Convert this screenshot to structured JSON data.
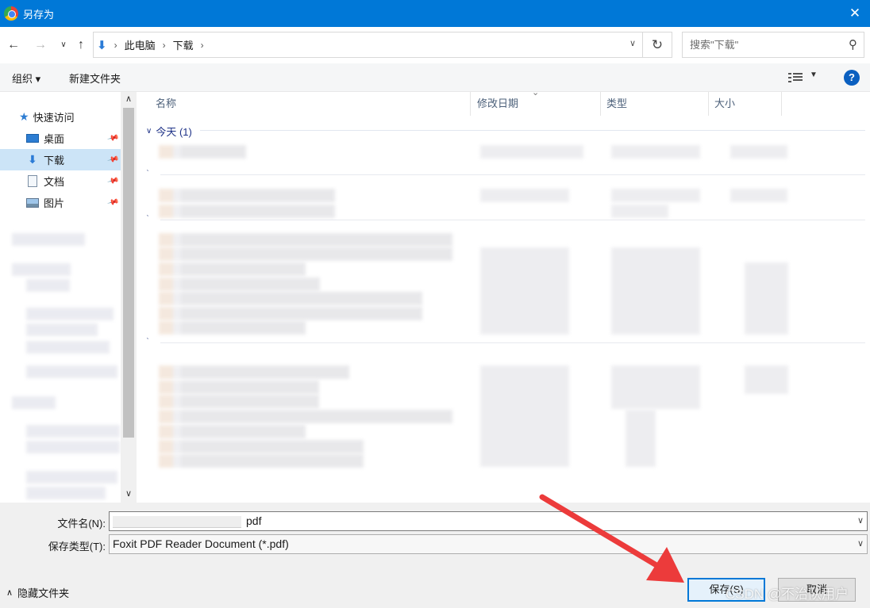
{
  "window": {
    "title": "另存为"
  },
  "address": {
    "crumbs": [
      "此电脑",
      "下载"
    ],
    "search_placeholder": "搜索\"下载\""
  },
  "toolbar": {
    "organize": "组织 ▾",
    "new_folder": "新建文件夹"
  },
  "nav": {
    "quick_access": "快速访问",
    "items": [
      {
        "label": "桌面",
        "icon": "desktop-icon"
      },
      {
        "label": "下载",
        "icon": "download-icon",
        "selected": true
      },
      {
        "label": "文档",
        "icon": "document-icon"
      },
      {
        "label": "图片",
        "icon": "pictures-icon"
      }
    ]
  },
  "columns": [
    "名称",
    "修改日期",
    "类型",
    "大小"
  ],
  "groups": {
    "today": "今天 (1)"
  },
  "form": {
    "filename_label": "文件名(N):",
    "filename_value": "pdf",
    "filetype_label": "保存类型(T):",
    "filetype_value": "Foxit PDF Reader Document (*.pdf)"
  },
  "footer": {
    "hide_folders": "隐藏文件夹",
    "save": "保存(S)",
    "cancel": "取消"
  },
  "watermark": "CSDN @不治队用户",
  "colors": {
    "titlebar": "#0078d7",
    "selected": "#cce4f7",
    "annotation_arrow": "#ec3b3b"
  }
}
